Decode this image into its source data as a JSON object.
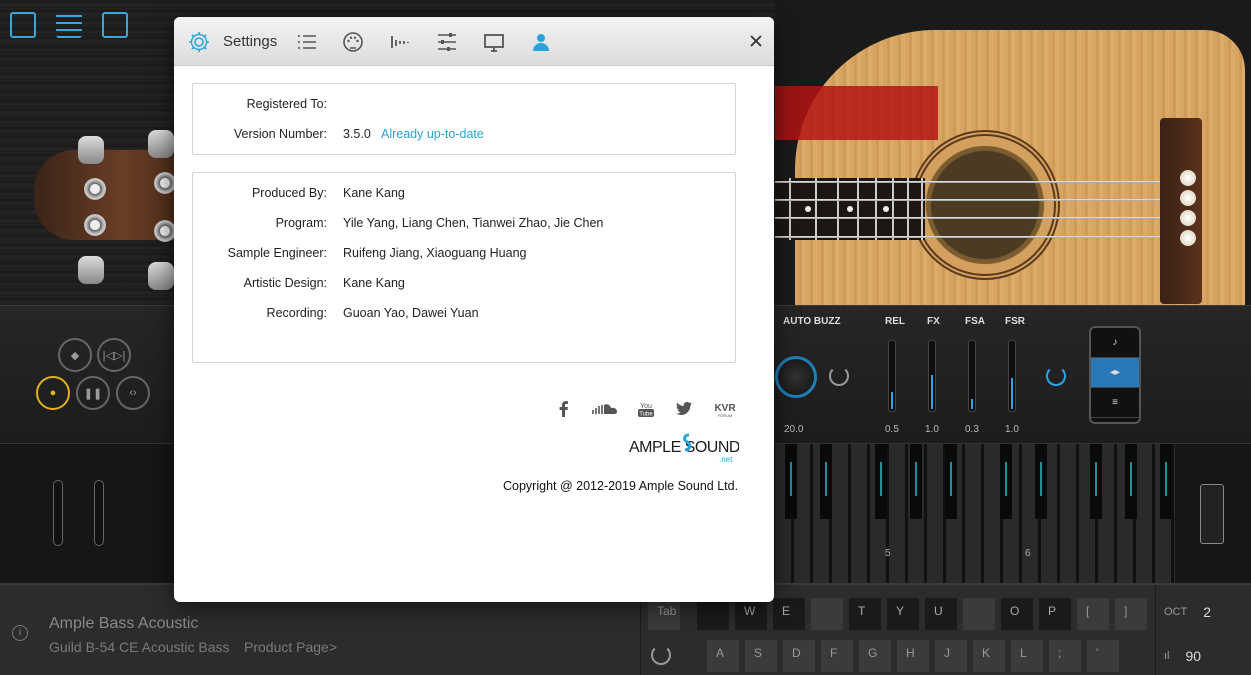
{
  "dialog": {
    "title": "Settings",
    "tabs": [
      "settings-icon",
      "list-icon",
      "midi-icon",
      "waveform-icon",
      "mixer-icon",
      "monitor-icon",
      "user-icon"
    ],
    "registration": {
      "registered_to_label": "Registered To:",
      "registered_to_value": "",
      "version_label": "Version Number:",
      "version_value": "3.5.0",
      "update_status": "Already up-to-date"
    },
    "credits": [
      {
        "label": "Produced By:",
        "value": "Kane Kang"
      },
      {
        "label": "Program:",
        "value": "Yile Yang, Liang Chen, Tianwei Zhao, Jie Chen"
      },
      {
        "label": "Sample Engineer:",
        "value": "Ruifeng Jiang, Xiaoguang Huang"
      },
      {
        "label": "Artistic Design:",
        "value": "Kane Kang"
      },
      {
        "label": "Recording:",
        "value": "Guoan Yao, Dawei Yuan"
      }
    ],
    "social": [
      "facebook-icon",
      "soundcloud-icon",
      "youtube-icon",
      "twitter-icon",
      "kvr-forum-icon"
    ],
    "logo": {
      "brand": "AMPLE SOUND",
      "suffix": ".net"
    },
    "copyright": "Copyright @ 2012-2019 Ample Sound Ltd."
  },
  "plugin": {
    "labels": {
      "auto_buzz": "AUTO BUZZ",
      "rel": "REL",
      "fx": "FX",
      "fsa": "FSA",
      "fsr": "FSR"
    },
    "values": {
      "auto_buzz": "20.0",
      "rel": "0.5",
      "fx": "1.0",
      "fsa": "0.3",
      "fsr": "1.0"
    },
    "slider_levels": {
      "rel": 0.25,
      "fx": 0.5,
      "fsa": 0.15,
      "fsr": 0.45
    },
    "octave_labels": [
      "5",
      "6"
    ]
  },
  "bottom": {
    "product_name": "Ample Bass Acoustic",
    "product_model": "Guild B-54 CE Acoustic Bass",
    "product_link": "Product Page>",
    "keyboard_row1": [
      "Tab",
      "",
      "W",
      "E",
      "",
      "T",
      "Y",
      "U",
      "",
      "O",
      "P",
      "[",
      "]"
    ],
    "keyboard_row2": [
      "A",
      "S",
      "D",
      "F",
      "G",
      "H",
      "J",
      "K",
      "L",
      ";",
      "'"
    ],
    "oct_label": "OCT",
    "oct_value": "2",
    "velocity_value": "90"
  },
  "colors": {
    "accent": "#29a4d8",
    "transport_active": "#e0b020",
    "red_bar": "#b41414"
  }
}
